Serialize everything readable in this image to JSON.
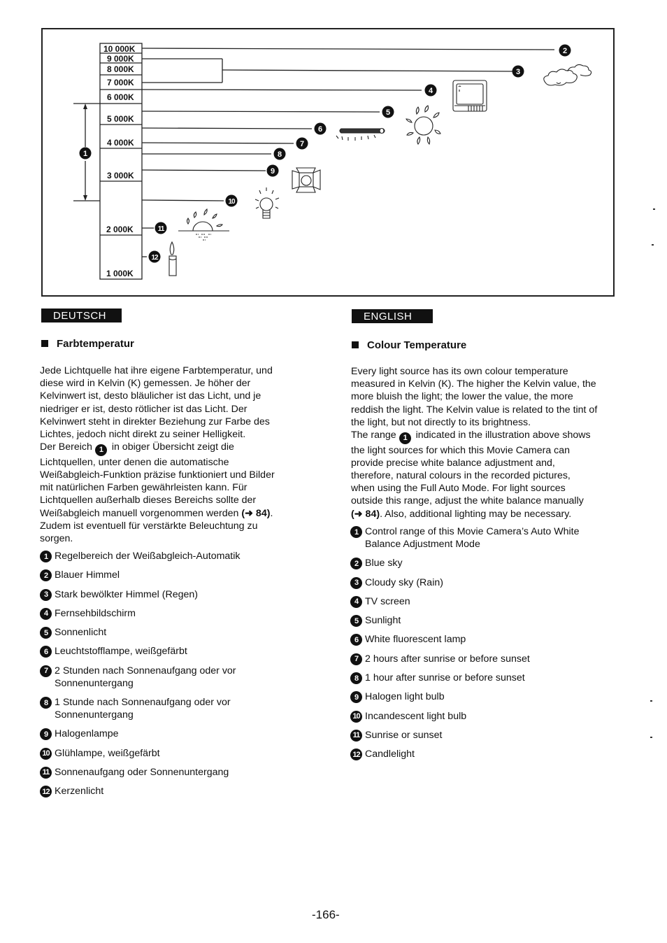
{
  "diagram": {
    "kelvin_scale": [
      "10 000K",
      "9 000K",
      "8 000K",
      "7 000K",
      "6 000K",
      "5 000K",
      "4 000K",
      "3 000K",
      "2 000K",
      "1 000K"
    ],
    "callouts": [
      "1",
      "2",
      "3",
      "4",
      "5",
      "6",
      "7",
      "8",
      "9",
      "10",
      "11",
      "12"
    ],
    "icons": {
      "2": "cloud-icon",
      "3": "cloud-icon",
      "4": "tv-screen-icon",
      "5": "sun-icon",
      "6": "fluorescent-lamp-icon",
      "9": "halogen-lamp-icon",
      "10": "light-bulb-icon",
      "11": "sunset-icon",
      "12": "candle-icon"
    }
  },
  "deutsch": {
    "tab_label": "DEUTSCH",
    "heading": "Farbtemperatur",
    "paragraph_lines": [
      "Jede Lichtquelle hat ihre eigene Farbtemperatur, und",
      "diese wird in Kelvin (K) gemessen. Je höher der",
      "Kelvinwert ist, desto bläulicher ist das Licht, und je",
      "niedriger er ist, desto rötlicher ist das Licht. Der",
      "Kelvinwert steht in direkter Beziehung zur Farbe des",
      "Lichtes, jedoch nicht direkt zu seiner Helligkeit."
    ],
    "paragraph2_pre": "Der Bereich",
    "paragraph2_badge": "1",
    "paragraph2_lines": [
      " in obiger Übersicht zeigt die",
      "Lichtquellen, unter denen die automatische",
      "Weißabgleich-Funktion präzise funktioniert und Bilder",
      "mit natürlichen Farben gewährleisten kann. Für",
      "Lichtquellen außerhalb dieses Bereichs sollte der",
      "Weißabgleich manuell vorgenommen werden ",
      "(➜ 84)",
      ".",
      "Zudem ist eventuell für verstärkte Beleuchtung zu",
      "sorgen."
    ],
    "items": [
      {
        "num": "1",
        "text": "Regelbereich der Weißabgleich-Automatik"
      },
      {
        "num": "2",
        "text": "Blauer Himmel"
      },
      {
        "num": "3",
        "text": "Stark bewölkter Himmel (Regen)"
      },
      {
        "num": "4",
        "text": "Fernsehbildschirm"
      },
      {
        "num": "5",
        "text": "Sonnenlicht"
      },
      {
        "num": "6",
        "text": "Leuchtstofflampe, weißgefärbt"
      },
      {
        "num": "7",
        "text": "2 Stunden nach Sonnenaufgang oder vor Sonnenuntergang"
      },
      {
        "num": "8",
        "text": "1 Stunde nach Sonnenaufgang oder vor Sonnenuntergang"
      },
      {
        "num": "9",
        "text": "Halogenlampe"
      },
      {
        "num": "10",
        "text": "Glühlampe, weißgefärbt"
      },
      {
        "num": "11",
        "text": "Sonnenaufgang oder Sonnenuntergang"
      },
      {
        "num": "12",
        "text": "Kerzenlicht"
      }
    ]
  },
  "english": {
    "tab_label": "ENGLISH",
    "heading": "Colour Temperature",
    "paragraph_lines": [
      "Every light source has its own colour temperature",
      "measured in Kelvin (K). The higher the Kelvin value, the",
      "more bluish the light; the lower the value, the more",
      "reddish the light. The Kelvin value is related to the tint of",
      "the light, but not directly to its brightness."
    ],
    "paragraph2_pre": "The range",
    "paragraph2_badge": "1",
    "paragraph2_lines": [
      " indicated in the illustration above shows",
      "the light sources for which this Movie Camera can",
      "provide precise white balance adjustment and,",
      "therefore, natural colours in the recorded pictures,",
      "when using the Full Auto Mode. For light sources",
      "outside this range, adjust the white balance manually",
      "(➜ 84)",
      ". Also, additional lighting may be necessary."
    ],
    "items": [
      {
        "num": "1",
        "text": "Control range of this Movie Camera’s Auto White Balance Adjustment Mode"
      },
      {
        "num": "2",
        "text": "Blue sky"
      },
      {
        "num": "3",
        "text": "Cloudy sky (Rain)"
      },
      {
        "num": "4",
        "text": "TV screen"
      },
      {
        "num": "5",
        "text": "Sunlight"
      },
      {
        "num": "6",
        "text": "White fluorescent lamp"
      },
      {
        "num": "7",
        "text": "2 hours after sunrise or before sunset"
      },
      {
        "num": "8",
        "text": "1 hour after sunrise or before sunset"
      },
      {
        "num": "9",
        "text": "Halogen light bulb"
      },
      {
        "num": "10",
        "text": "Incandescent light bulb"
      },
      {
        "num": "11",
        "text": "Sunrise or sunset"
      },
      {
        "num": "12",
        "text": "Candlelight"
      }
    ]
  },
  "page_number": "-166-"
}
